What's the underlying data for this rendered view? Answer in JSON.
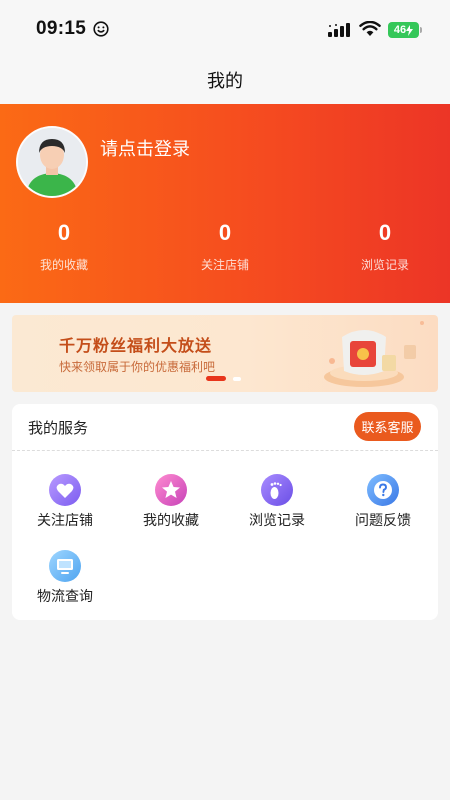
{
  "status_bar": {
    "time": "09:15",
    "battery": "46"
  },
  "nav": {
    "title": "我的"
  },
  "profile": {
    "login_prompt": "请点击登录",
    "stats": [
      {
        "value": "0",
        "label": "我的收藏"
      },
      {
        "value": "0",
        "label": "关注店铺"
      },
      {
        "value": "0",
        "label": "浏览记录"
      }
    ]
  },
  "banner": {
    "title": "千万粉丝福利大放送",
    "subtitle": "快来领取属于你的优惠福利吧"
  },
  "services": {
    "title": "我的服务",
    "contact_label": "联系客服",
    "items": [
      {
        "label": "关注店铺",
        "icon": "heart-icon"
      },
      {
        "label": "我的收藏",
        "icon": "star-icon"
      },
      {
        "label": "浏览记录",
        "icon": "footprint-icon"
      },
      {
        "label": "问题反馈",
        "icon": "question-icon"
      },
      {
        "label": "物流查询",
        "icon": "monitor-icon"
      }
    ]
  },
  "colors": {
    "accent": "#ea5a1e",
    "header_gradient_start": "#fb6a15",
    "header_gradient_end": "#ec3526"
  }
}
